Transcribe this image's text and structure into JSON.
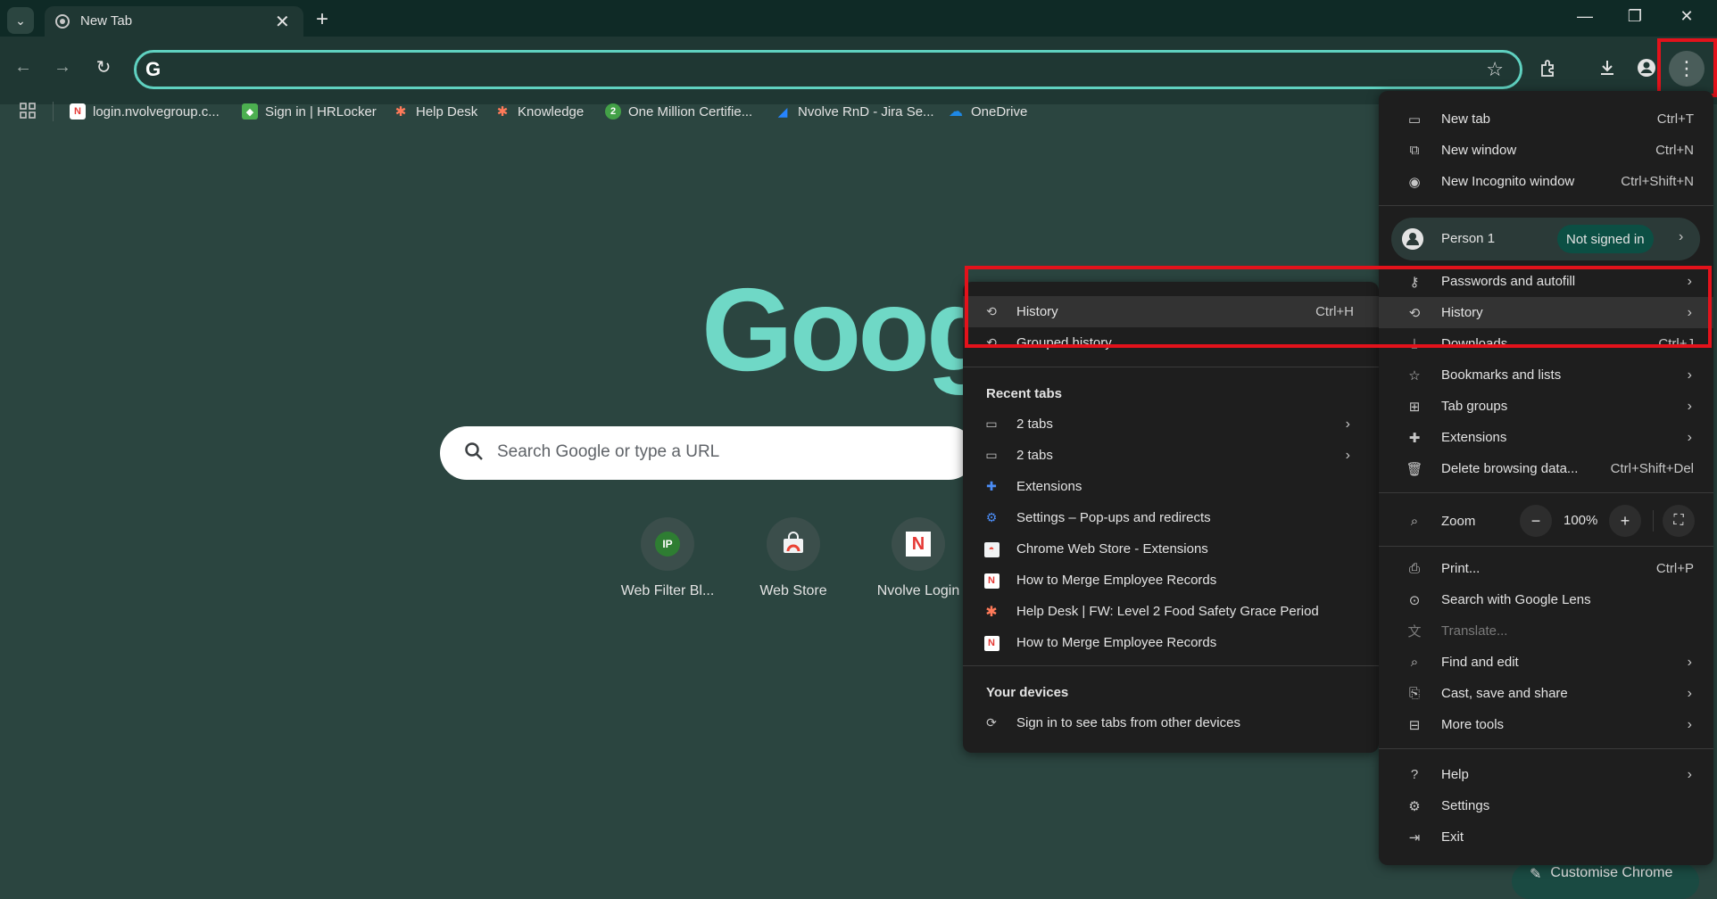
{
  "tab": {
    "title": "New Tab",
    "close": "✕"
  },
  "window_controls": {
    "minimize": "—",
    "restore": "❐",
    "close": "✕"
  },
  "toolbar": {
    "back": "←",
    "forward": "→",
    "reload": "↻",
    "omnibox_value": ""
  },
  "bookmarks": [
    {
      "label": "login.nvolvegroup.c...",
      "icon": "nvolve-n-icon",
      "color": "#e53935"
    },
    {
      "label": "Sign in | HRLocker",
      "icon": "hrlocker-icon",
      "color": "#4caf50"
    },
    {
      "label": "Help Desk",
      "icon": "hubspot-icon",
      "color": "#ff7a59"
    },
    {
      "label": "Knowledge",
      "icon": "hubspot-icon",
      "color": "#ff7a59"
    },
    {
      "label": "One Million Certifie...",
      "icon": "number-2-icon",
      "color": "#43a047"
    },
    {
      "label": "Nvolve RnD - Jira Se...",
      "icon": "jira-icon",
      "color": "#2684ff"
    },
    {
      "label": "OneDrive",
      "icon": "onedrive-cloud-icon",
      "color": "#1e88e5"
    }
  ],
  "ntp": {
    "logo": "Google",
    "search_placeholder": "Search Google or type a URL",
    "shortcuts": [
      {
        "label": "Web Filter Bl...",
        "icon_text": "IP"
      },
      {
        "label": "Web Store",
        "icon_text": ""
      },
      {
        "label": "Nvolve Login",
        "icon_text": "N"
      }
    ],
    "customize": "Customise Chrome"
  },
  "main_menu": {
    "new_tab": {
      "label": "New tab",
      "shortcut": "Ctrl+T"
    },
    "new_window": {
      "label": "New window",
      "shortcut": "Ctrl+N"
    },
    "new_incognito": {
      "label": "New Incognito window",
      "shortcut": "Ctrl+Shift+N"
    },
    "person": {
      "name": "Person 1",
      "status": "Not signed in"
    },
    "passwords": {
      "label": "Passwords and autofill"
    },
    "history": {
      "label": "History"
    },
    "downloads": {
      "label": "Downloads",
      "shortcut": "Ctrl+J"
    },
    "bookmarks": {
      "label": "Bookmarks and lists"
    },
    "tab_groups": {
      "label": "Tab groups"
    },
    "extensions": {
      "label": "Extensions"
    },
    "delete_data": {
      "label": "Delete browsing data...",
      "shortcut": "Ctrl+Shift+Del"
    },
    "zoom": {
      "label": "Zoom",
      "minus": "−",
      "value": "100%",
      "plus": "+"
    },
    "print": {
      "label": "Print...",
      "shortcut": "Ctrl+P"
    },
    "lens": {
      "label": "Search with Google Lens"
    },
    "translate": {
      "label": "Translate..."
    },
    "find_edit": {
      "label": "Find and edit"
    },
    "cast": {
      "label": "Cast, save and share"
    },
    "more_tools": {
      "label": "More tools"
    },
    "help": {
      "label": "Help"
    },
    "settings": {
      "label": "Settings"
    },
    "exit": {
      "label": "Exit"
    }
  },
  "history_menu": {
    "history": {
      "label": "History",
      "shortcut": "Ctrl+H"
    },
    "grouped": {
      "label": "Grouped history"
    },
    "recent_heading": "Recent tabs",
    "recent": [
      {
        "label": "2 tabs",
        "icon": "window-icon",
        "arrow": true
      },
      {
        "label": "2 tabs",
        "icon": "window-icon",
        "arrow": true
      },
      {
        "label": "Extensions",
        "icon": "puzzle-icon",
        "arrow": false
      },
      {
        "label": "Settings – Pop-ups and redirects",
        "icon": "settings-gear-icon",
        "arrow": false
      },
      {
        "label": "Chrome Web Store - Extensions",
        "icon": "webstore-icon",
        "arrow": false
      },
      {
        "label": "How to Merge Employee Records",
        "icon": "nvolve-n-icon",
        "arrow": false
      },
      {
        "label": "Help Desk | FW: Level 2 Food Safety Grace Period",
        "icon": "hubspot-icon",
        "arrow": false
      },
      {
        "label": "How to Merge Employee Records",
        "icon": "nvolve-n-icon",
        "arrow": false
      }
    ],
    "devices_heading": "Your devices",
    "devices_signin": "Sign in to see tabs from other devices"
  }
}
